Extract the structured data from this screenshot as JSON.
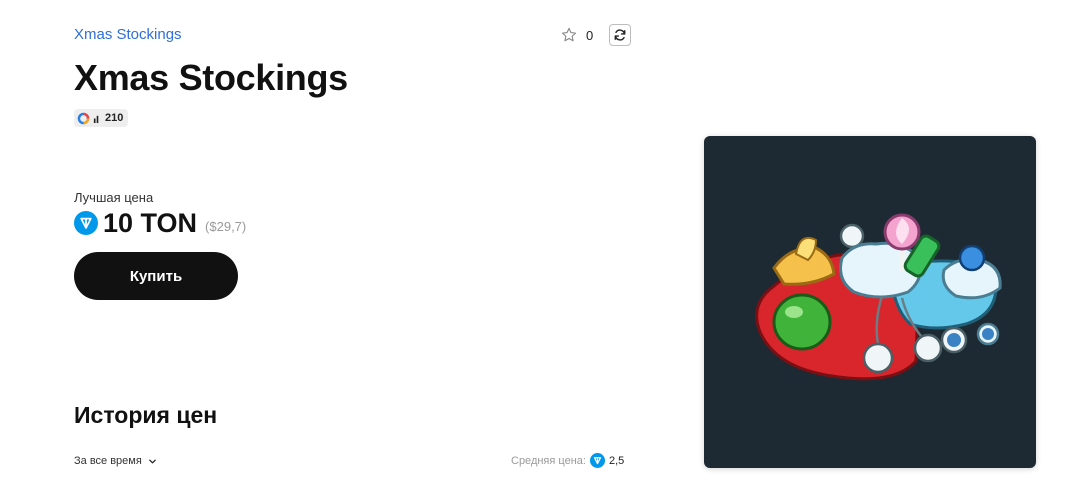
{
  "breadcrumb": {
    "label": "Xmas Stockings"
  },
  "favorites": {
    "count": "0"
  },
  "item": {
    "title": "Xmas Stockings",
    "stat_value": "210"
  },
  "price": {
    "best_label": "Лучшая цена",
    "amount": "10 TON",
    "usd": "($29,7)",
    "buy_label": "Купить"
  },
  "history": {
    "title": "История цен",
    "period_label": "За все время",
    "average_label": "Средняя цена:",
    "average_value": "2,5"
  },
  "colors": {
    "accent_link": "#2f6fd9",
    "ton_blue": "#0098ea",
    "button_bg": "#111111",
    "card_bg": "#1d2a33"
  },
  "icons": {
    "favorite": "star-icon",
    "refresh": "refresh-icon",
    "stat": "ring-icon",
    "currency": "ton-icon",
    "period": "chevron-down-icon"
  }
}
